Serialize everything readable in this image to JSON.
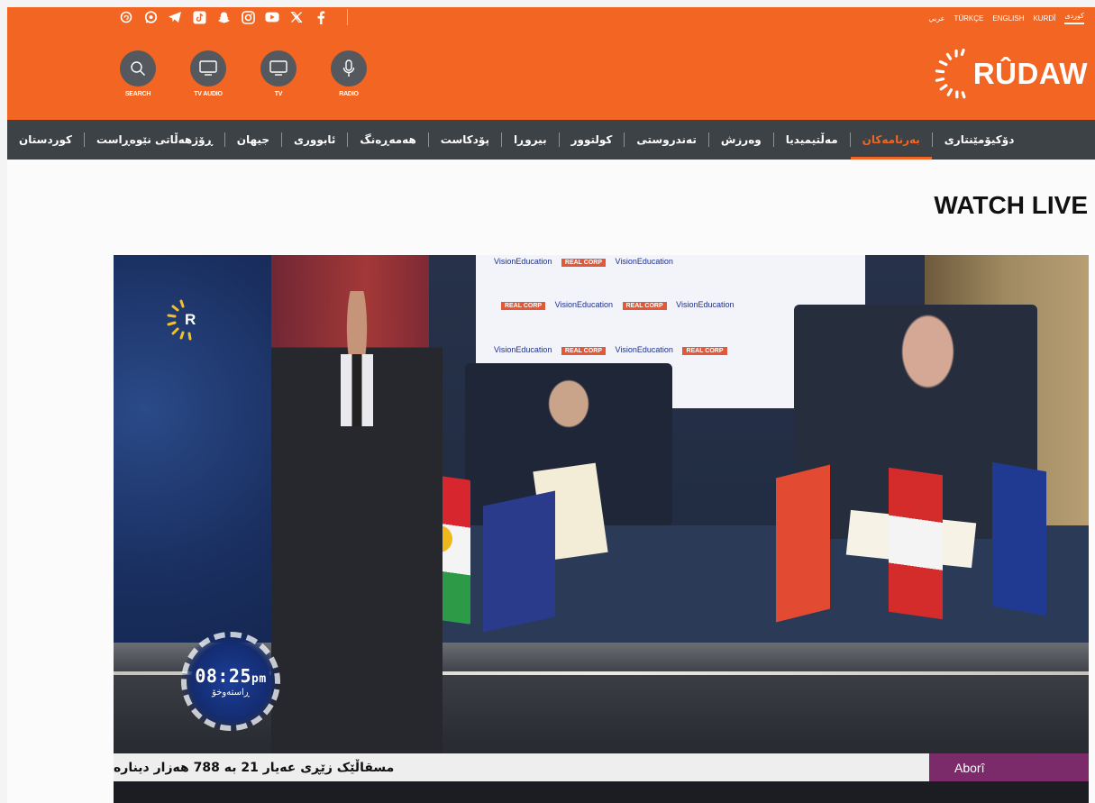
{
  "header": {
    "social_icons": [
      "threads-icon",
      "whatsapp-icon",
      "telegram-icon",
      "tiktok-icon",
      "snapchat-icon",
      "instagram-icon",
      "youtube-icon",
      "x-icon",
      "facebook-icon"
    ],
    "languages": [
      {
        "label": "کوردی",
        "active": true
      },
      {
        "label": "KURDÎ",
        "active": false
      },
      {
        "label": "ENGLISH",
        "active": false
      },
      {
        "label": "TÜRKÇE",
        "active": false
      },
      {
        "label": "عربي",
        "active": false
      }
    ],
    "media_buttons": [
      {
        "label": "SEARCH",
        "icon": "search-icon"
      },
      {
        "label": "TV AUDIO",
        "icon": "tv-audio-icon"
      },
      {
        "label": "TV",
        "icon": "tv-icon"
      },
      {
        "label": "RADIO",
        "icon": "microphone-icon"
      }
    ],
    "logo_text": "RÛDAW",
    "brand_color": "#f26522"
  },
  "nav": {
    "items": [
      {
        "label": "کوردستان",
        "active": false
      },
      {
        "label": "ڕۆژهەڵاتی نێوەڕاست",
        "active": false
      },
      {
        "label": "جیهان",
        "active": false
      },
      {
        "label": "ئابووری",
        "active": false
      },
      {
        "label": "هەمەڕەنگ",
        "active": false
      },
      {
        "label": "پۆدکاست",
        "active": false
      },
      {
        "label": "بیروڕا",
        "active": false
      },
      {
        "label": "کولتوور",
        "active": false
      },
      {
        "label": "تەندروستی",
        "active": false
      },
      {
        "label": "وەرزش",
        "active": false
      },
      {
        "label": "مەڵتیمیدیا",
        "active": false
      },
      {
        "label": "بەرنامەکان",
        "active": true
      },
      {
        "label": "دۆکیۆمێنتاری",
        "active": false
      }
    ]
  },
  "page": {
    "title": "WATCH LIVE"
  },
  "video": {
    "backdrop_brand_1": "VisionEducation",
    "backdrop_brand_2": "REAL CORP",
    "clock_time": "08:25",
    "clock_suffix": "pm",
    "clock_label": "ڕاستەوخۆ",
    "ticker_headline": "مسقاڵێک زێڕی عەیار 21 بە 788 هەزار دینارە",
    "ticker_category": "Aborî"
  }
}
